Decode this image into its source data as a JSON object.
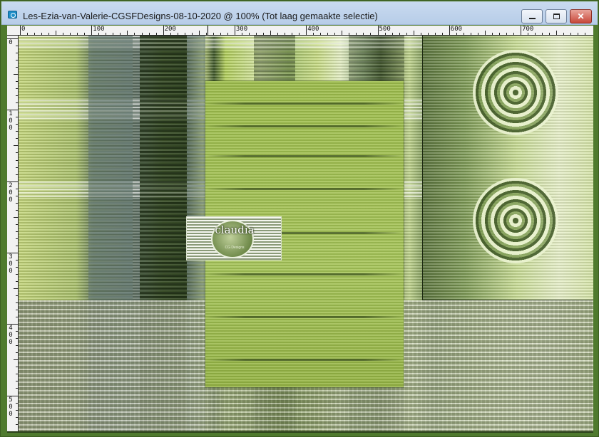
{
  "window": {
    "title": "Les-Ezia-van-Valerie-CGSFDesigns-08-10-2020 @ 100% (Tot laag gemaakte selectie)",
    "icon": "psp-app-icon",
    "controls": {
      "minimize": "minimize",
      "maximize": "maximize",
      "close": "✕"
    }
  },
  "ruler": {
    "horizontal_labels": [
      "0",
      "100",
      "200",
      "300",
      "400",
      "500",
      "600",
      "700"
    ],
    "vertical_labels": [
      "0",
      "1\n0\n0",
      "2\n0\n0",
      "3\n0\n0",
      "4\n0\n0",
      "5\n0\n0"
    ]
  },
  "watermark": {
    "text": "claudia",
    "subtext": "CG Designs"
  },
  "colors": {
    "titlebar": "#c9daf0",
    "window_border": "#4f7a2e",
    "accent_green": "#a7c55a"
  }
}
